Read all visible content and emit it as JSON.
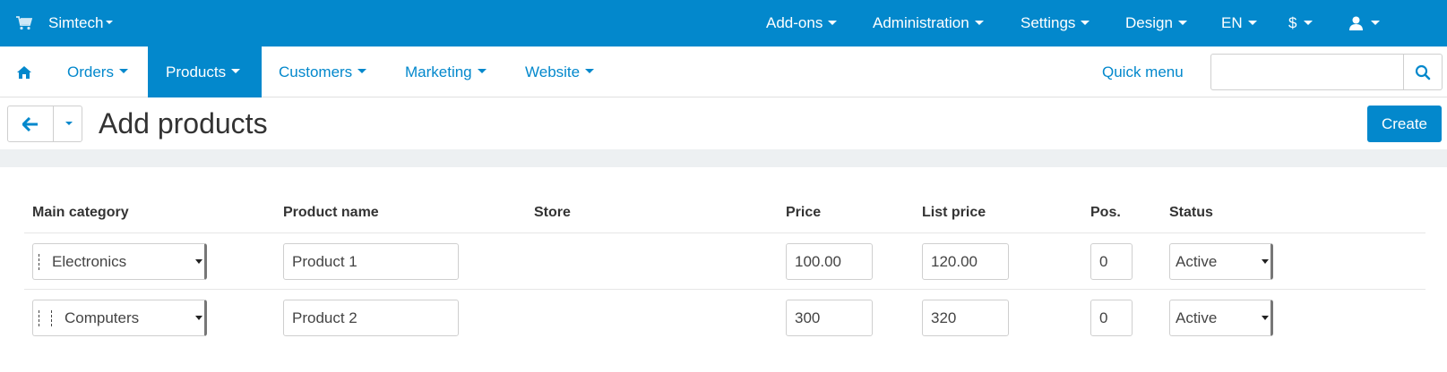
{
  "topbar": {
    "store_name": "Simtech",
    "menus": [
      "Add-ons",
      "Administration",
      "Settings",
      "Design",
      "EN",
      "$"
    ]
  },
  "nav": {
    "items": [
      "Orders",
      "Products",
      "Customers",
      "Marketing",
      "Website"
    ],
    "active": "Products",
    "quick_menu": "Quick menu",
    "search_placeholder": ""
  },
  "page": {
    "title": "Add products",
    "create_label": "Create"
  },
  "table": {
    "headers": [
      "Main category",
      "Product name",
      "Store",
      "Price",
      "List price",
      "Pos.",
      "Status"
    ],
    "rows": [
      {
        "category": "Electronics",
        "category_depth": 1,
        "name": "Product 1",
        "store": "",
        "price": "100.00",
        "list_price": "120.00",
        "pos": "0",
        "status": "Active"
      },
      {
        "category": "Computers",
        "category_depth": 2,
        "name": "Product 2",
        "store": "",
        "price": "300",
        "list_price": "320",
        "pos": "0",
        "status": "Active"
      }
    ]
  },
  "colors": {
    "accent": "#0388cc",
    "page_bg": "#edf0f2"
  }
}
